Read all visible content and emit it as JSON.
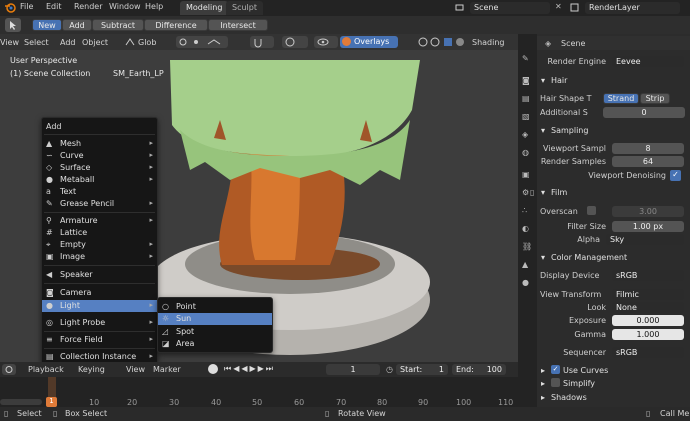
{
  "menubar": {
    "items": [
      "File",
      "Edit",
      "Render",
      "Window",
      "Help"
    ],
    "workspaces": [
      "Modeling",
      "Sculpt"
    ],
    "scene_field": "Scene",
    "render_layer_field": "RenderLayer"
  },
  "toolbar": {
    "mode_buttons": [
      "New",
      "Add",
      "Subtract",
      "Difference",
      "Intersect"
    ]
  },
  "view_header": {
    "items": [
      "View",
      "Select",
      "Add",
      "Object"
    ],
    "orientation": "Glob",
    "overlays": "Overlays",
    "shading": "Shading"
  },
  "viewport": {
    "line1": "User Perspective",
    "line2": "(1) Scene Collection",
    "object_name": "SM_Earth_LP"
  },
  "add_menu": {
    "title": "Add",
    "items": [
      {
        "label": "Mesh",
        "icon": "mesh-icon",
        "submenu": true
      },
      {
        "label": "Curve",
        "icon": "curve-icon",
        "submenu": true
      },
      {
        "label": "Surface",
        "icon": "surface-icon",
        "submenu": true
      },
      {
        "label": "Metaball",
        "icon": "metaball-icon",
        "submenu": true
      },
      {
        "label": "Text",
        "icon": "text-icon",
        "submenu": false
      },
      {
        "label": "Grease Pencil",
        "icon": "grease-pencil-icon",
        "submenu": true
      },
      {
        "label": "Armature",
        "icon": "armature-icon",
        "submenu": true
      },
      {
        "label": "Lattice",
        "icon": "lattice-icon",
        "submenu": false
      },
      {
        "label": "Empty",
        "icon": "empty-icon",
        "submenu": true
      },
      {
        "label": "Image",
        "icon": "image-icon",
        "submenu": true
      },
      {
        "label": "Speaker",
        "icon": "speaker-icon",
        "submenu": false
      },
      {
        "label": "Camera",
        "icon": "camera-icon",
        "submenu": false
      },
      {
        "label": "Light",
        "icon": "light-icon",
        "submenu": true
      },
      {
        "label": "Light Probe",
        "icon": "light-probe-icon",
        "submenu": true
      },
      {
        "label": "Force Field",
        "icon": "force-field-icon",
        "submenu": true
      },
      {
        "label": "Collection Instance",
        "icon": "collection-icon",
        "submenu": true
      }
    ]
  },
  "light_submenu": {
    "items": [
      "Point",
      "Sun",
      "Spot",
      "Area"
    ]
  },
  "timeline_header": {
    "items": [
      "Playback",
      "Keying",
      "View",
      "Marker"
    ],
    "current_frame": "1",
    "start_label": "Start:",
    "start_value": "1",
    "end_label": "End:",
    "end_value": "100"
  },
  "timeline": {
    "ticks": [
      "1",
      "10",
      "20",
      "30",
      "40",
      "50",
      "60",
      "70",
      "80",
      "90",
      "100",
      "110"
    ]
  },
  "statusbar": {
    "select": "Select",
    "box_select": "Box Select",
    "rotate_view": "Rotate View",
    "call_menu": "Call Me"
  },
  "properties": {
    "header": "Scene",
    "render_engine_label": "Render Engine",
    "render_engine": "Eevee",
    "hair_section": "Hair",
    "hair_shape_label": "Hair Shape T",
    "hair_shape_options": [
      "Strand",
      "Strip"
    ],
    "additional_label": "Additional S",
    "additional_value": "0",
    "sampling_section": "Sampling",
    "viewport_samples_label": "Viewport Sampl",
    "viewport_samples": "8",
    "render_samples_label": "Render Samples",
    "render_samples": "64",
    "viewport_denoising": "Viewport Denoising",
    "film_section": "Film",
    "overscan_label": "Overscan",
    "overscan_value": "3.00",
    "filter_size_label": "Filter Size",
    "filter_size_value": "1.00 px",
    "alpha_label": "Alpha",
    "alpha_value": "Sky",
    "color_management_section": "Color Management",
    "display_device_label": "Display Device",
    "display_device": "sRGB",
    "view_transform_label": "View Transform",
    "view_transform": "Filmic",
    "look_label": "Look",
    "look": "None",
    "exposure_label": "Exposure",
    "exposure": "0.000",
    "gamma_label": "Gamma",
    "gamma": "1.000",
    "sequencer_label": "Sequencer",
    "sequencer": "sRGB",
    "use_curves": "Use Curves",
    "simplify_section": "Simplify",
    "shadows_section": "Shadows"
  },
  "colors": {
    "accent": "#4772b3",
    "highlight": "#5680c2",
    "frame_marker": "#e07b39"
  }
}
